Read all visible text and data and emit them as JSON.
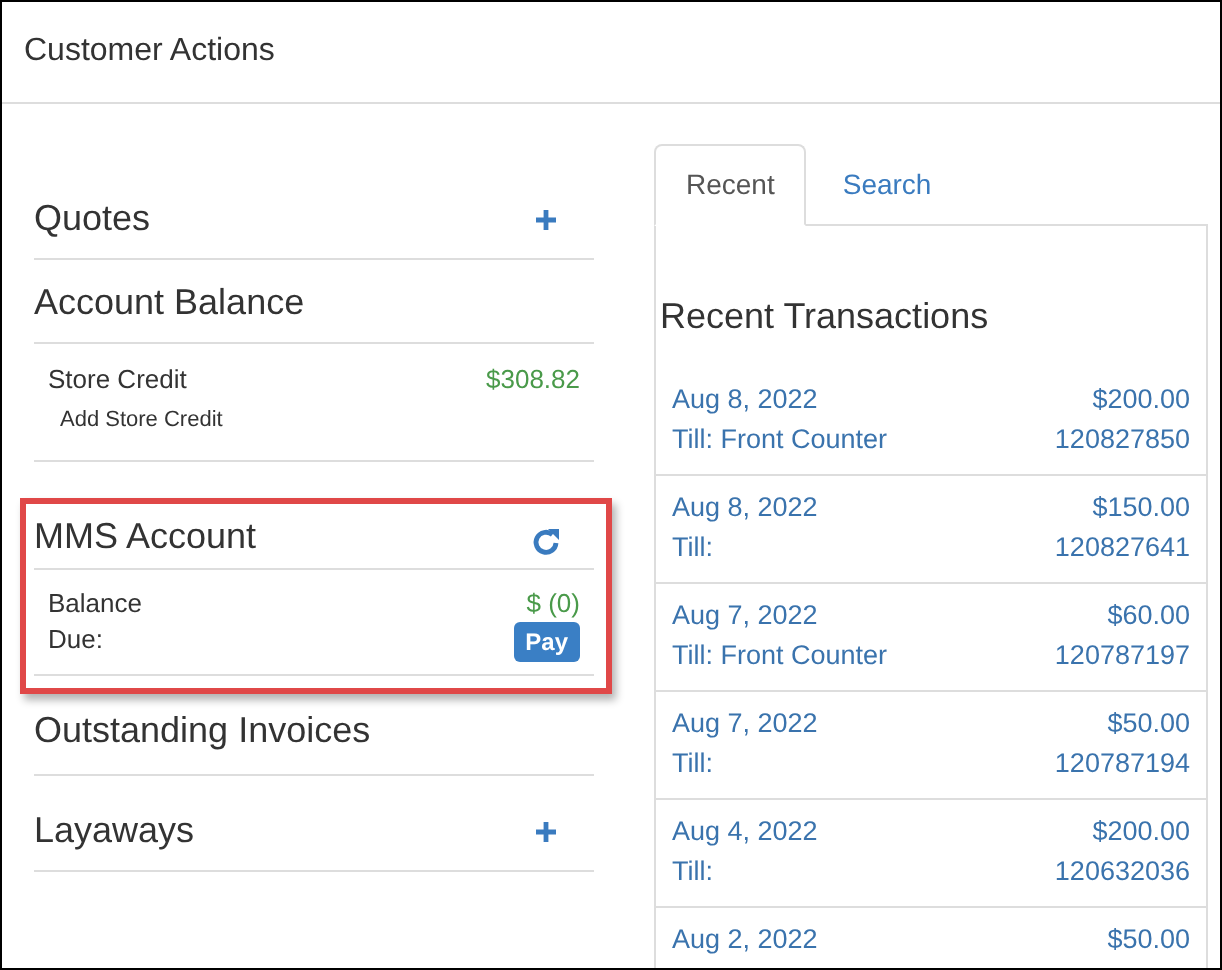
{
  "window": {
    "title": "Customer Actions"
  },
  "sections": [
    {
      "kind": "add",
      "title": "Quotes"
    },
    {
      "kind": "balance",
      "title": "Account Balance",
      "label": "Store Credit",
      "amount": "$308.82",
      "link": "Add Store Credit"
    },
    {
      "kind": "account",
      "title": "MMS Account",
      "highlighted": true,
      "label": "Balance Due:",
      "amount": "$ (0)",
      "button": "Pay"
    },
    {
      "kind": "plain",
      "title": "Outstanding Invoices"
    },
    {
      "kind": "add",
      "title": "Layaways"
    }
  ],
  "tabs": [
    {
      "label": "Recent",
      "selected": true
    },
    {
      "label": "Search",
      "selected": false
    }
  ],
  "recent": {
    "title": "Recent Transactions",
    "rows": [
      {
        "date": "Aug 8, 2022",
        "amount": "$200.00",
        "till": "Till: Front Counter",
        "number": "120827850"
      },
      {
        "date": "Aug 8, 2022",
        "amount": "$150.00",
        "till": "Till:",
        "number": "120827641"
      },
      {
        "date": "Aug 7, 2022",
        "amount": "$60.00",
        "till": "Till: Front Counter",
        "number": "120787197"
      },
      {
        "date": "Aug 7, 2022",
        "amount": "$50.00",
        "till": "Till:",
        "number": "120787194"
      },
      {
        "date": "Aug 4, 2022",
        "amount": "$200.00",
        "till": "Till:",
        "number": "120632036"
      },
      {
        "date": "Aug 2, 2022",
        "amount": "$50.00"
      }
    ]
  }
}
